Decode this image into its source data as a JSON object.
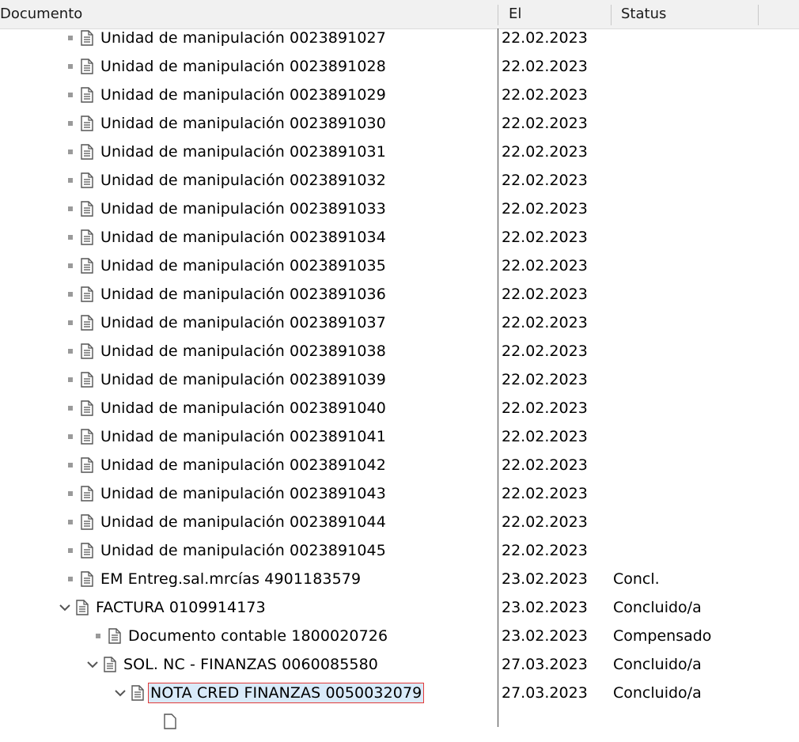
{
  "header": {
    "col_document": "Documento",
    "col_date": "El",
    "col_status": "Status"
  },
  "rows": [
    {
      "label": "Unidad de manipulación 0023891027",
      "date": "22.02.2023",
      "status": "",
      "level": 0,
      "type": "leaf"
    },
    {
      "label": "Unidad de manipulación 0023891028",
      "date": "22.02.2023",
      "status": "",
      "level": 0,
      "type": "leaf"
    },
    {
      "label": "Unidad de manipulación 0023891029",
      "date": "22.02.2023",
      "status": "",
      "level": 0,
      "type": "leaf"
    },
    {
      "label": "Unidad de manipulación 0023891030",
      "date": "22.02.2023",
      "status": "",
      "level": 0,
      "type": "leaf"
    },
    {
      "label": "Unidad de manipulación 0023891031",
      "date": "22.02.2023",
      "status": "",
      "level": 0,
      "type": "leaf"
    },
    {
      "label": "Unidad de manipulación 0023891032",
      "date": "22.02.2023",
      "status": "",
      "level": 0,
      "type": "leaf"
    },
    {
      "label": "Unidad de manipulación 0023891033",
      "date": "22.02.2023",
      "status": "",
      "level": 0,
      "type": "leaf"
    },
    {
      "label": "Unidad de manipulación 0023891034",
      "date": "22.02.2023",
      "status": "",
      "level": 0,
      "type": "leaf"
    },
    {
      "label": "Unidad de manipulación 0023891035",
      "date": "22.02.2023",
      "status": "",
      "level": 0,
      "type": "leaf"
    },
    {
      "label": "Unidad de manipulación 0023891036",
      "date": "22.02.2023",
      "status": "",
      "level": 0,
      "type": "leaf"
    },
    {
      "label": "Unidad de manipulación 0023891037",
      "date": "22.02.2023",
      "status": "",
      "level": 0,
      "type": "leaf"
    },
    {
      "label": "Unidad de manipulación 0023891038",
      "date": "22.02.2023",
      "status": "",
      "level": 0,
      "type": "leaf"
    },
    {
      "label": "Unidad de manipulación 0023891039",
      "date": "22.02.2023",
      "status": "",
      "level": 0,
      "type": "leaf"
    },
    {
      "label": "Unidad de manipulación 0023891040",
      "date": "22.02.2023",
      "status": "",
      "level": 0,
      "type": "leaf"
    },
    {
      "label": "Unidad de manipulación 0023891041",
      "date": "22.02.2023",
      "status": "",
      "level": 0,
      "type": "leaf"
    },
    {
      "label": "Unidad de manipulación 0023891042",
      "date": "22.02.2023",
      "status": "",
      "level": 0,
      "type": "leaf"
    },
    {
      "label": "Unidad de manipulación 0023891043",
      "date": "22.02.2023",
      "status": "",
      "level": 0,
      "type": "leaf"
    },
    {
      "label": "Unidad de manipulación 0023891044",
      "date": "22.02.2023",
      "status": "",
      "level": 0,
      "type": "leaf"
    },
    {
      "label": "Unidad de manipulación 0023891045",
      "date": "22.02.2023",
      "status": "",
      "level": 0,
      "type": "leaf"
    },
    {
      "label": "EM Entreg.sal.mrcías 4901183579",
      "date": "23.02.2023",
      "status": "Concl.",
      "level": 0,
      "type": "leaf"
    },
    {
      "label": "FACTURA 0109914173",
      "date": "23.02.2023",
      "status": "Concluido/a",
      "level": 0,
      "type": "expanded"
    },
    {
      "label": "Documento contable 1800020726",
      "date": "23.02.2023",
      "status": "Compensado",
      "level": 1,
      "type": "leaf"
    },
    {
      "label": "SOL. NC - FINANZAS 0060085580",
      "date": "27.03.2023",
      "status": "Concluido/a",
      "level": 1,
      "type": "expanded"
    },
    {
      "label": "NOTA CRED FINANZAS 0050032079",
      "date": "27.03.2023",
      "status": "Concluido/a",
      "level": 2,
      "type": "expanded",
      "selected": true
    }
  ],
  "icons": {
    "bullet": "tree-bullet-icon",
    "expanded": "chevron-down-icon",
    "document": "document-icon"
  },
  "colors": {
    "selection_bg": "#d9eaf9",
    "selection_border": "#e23a3a",
    "header_bg": "#f1f1f1"
  }
}
